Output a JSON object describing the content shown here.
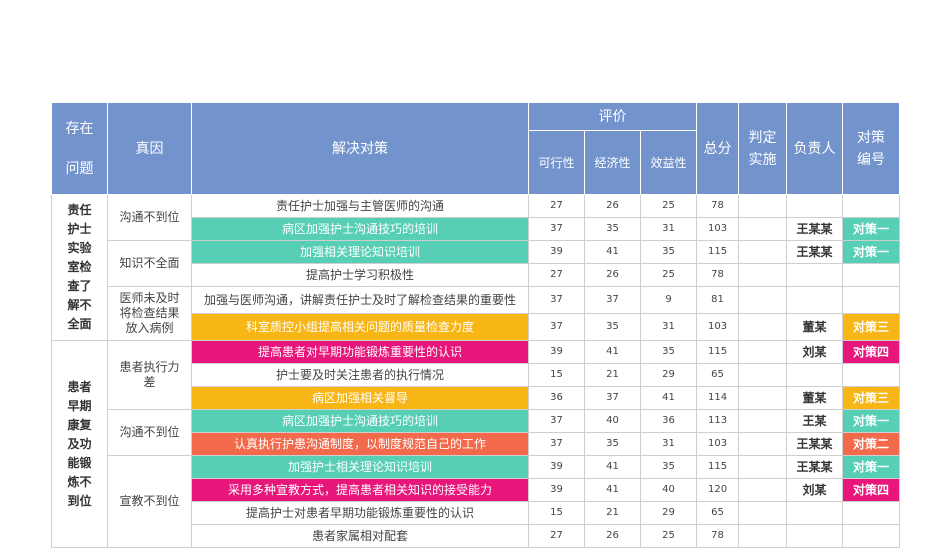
{
  "headers": {
    "problem_line1": "存在",
    "problem_line2": "问题",
    "cause": "真因",
    "measure": "解决对策",
    "evaluation": "评价",
    "feasibility": "可行性",
    "economy": "经济性",
    "benefit": "效益性",
    "total": "总分",
    "decision_line1": "判定",
    "decision_line2": "实施",
    "owner": "负责人",
    "code_line1": "对策",
    "code_line2": "编号"
  },
  "colors": {
    "header": "#7393cc",
    "green": "#56cfb5",
    "orange": "#f8b616",
    "pink": "#e8157b",
    "red": "#f26a4b"
  },
  "groups": [
    {
      "problem": "责任护士实验室检查了解不全面",
      "problem_lines": [
        "责任",
        "护士",
        "实验",
        "室检",
        "查了",
        "解不",
        "全面"
      ],
      "causes": [
        {
          "cause": "沟通不到位",
          "rows": [
            {
              "measure": "责任护士加强与主管医师的沟通",
              "feasibility": "27",
              "economy": "26",
              "benefit": "25",
              "total": "78",
              "owner": "",
              "code": "",
              "color": ""
            },
            {
              "measure": "病区加强护士沟通技巧的培训",
              "feasibility": "37",
              "economy": "35",
              "benefit": "31",
              "total": "103",
              "owner": "王某某",
              "code": "对策一",
              "color": "green"
            }
          ]
        },
        {
          "cause": "知识不全面",
          "rows": [
            {
              "measure": "加强相关理论知识培训",
              "feasibility": "39",
              "economy": "41",
              "benefit": "35",
              "total": "115",
              "owner": "王某某",
              "code": "对策一",
              "color": "green"
            },
            {
              "measure": "提高护士学习积极性",
              "feasibility": "27",
              "economy": "26",
              "benefit": "25",
              "total": "78",
              "owner": "",
              "code": "",
              "color": ""
            }
          ]
        },
        {
          "cause": "医师未及时将检查结果放入病例",
          "cause_lines": [
            "医师未及时",
            "将检查结果",
            "放入病例"
          ],
          "rows": [
            {
              "measure": "加强与医师沟通，讲解责任护士及时了解检查结果的重要性",
              "feasibility": "37",
              "economy": "37",
              "benefit": "9",
              "total": "81",
              "owner": "",
              "code": "",
              "color": ""
            },
            {
              "measure": "科室质控小组提高相关问题的质量检查力度",
              "feasibility": "37",
              "economy": "35",
              "benefit": "31",
              "total": "103",
              "owner": "董某",
              "code": "对策三",
              "color": "orange"
            }
          ]
        }
      ]
    },
    {
      "problem": "患者早期康复及功能锻炼不到位",
      "problem_lines": [
        "患者",
        "早期",
        "康复",
        "及功",
        "能锻",
        "炼不",
        "到位"
      ],
      "causes": [
        {
          "cause": "患者执行力差",
          "cause_lines": [
            "患者执行力",
            "差"
          ],
          "rows": [
            {
              "measure": "提高患者对早期功能锻炼重要性的认识",
              "feasibility": "39",
              "economy": "41",
              "benefit": "35",
              "total": "115",
              "owner": "刘某",
              "code": "对策四",
              "color": "pink"
            },
            {
              "measure": "护士要及时关注患者的执行情况",
              "feasibility": "15",
              "economy": "21",
              "benefit": "29",
              "total": "65",
              "owner": "",
              "code": "",
              "color": ""
            },
            {
              "measure": "病区加强相关督导",
              "feasibility": "36",
              "economy": "37",
              "benefit": "41",
              "total": "114",
              "owner": "董某",
              "code": "对策三",
              "color": "orange"
            }
          ]
        },
        {
          "cause": "沟通不到位",
          "rows": [
            {
              "measure": "病区加强护士沟通技巧的培训",
              "feasibility": "37",
              "economy": "40",
              "benefit": "36",
              "total": "113",
              "owner": "王某",
              "code": "对策一",
              "color": "green"
            },
            {
              "measure": "认真执行护患沟通制度，以制度规范自己的工作",
              "feasibility": "37",
              "economy": "35",
              "benefit": "31",
              "total": "103",
              "owner": "王某某",
              "code": "对策二",
              "color": "red"
            }
          ]
        },
        {
          "cause": "宣教不到位",
          "rows": [
            {
              "measure": "加强护士相关理论知识培训",
              "feasibility": "39",
              "economy": "41",
              "benefit": "35",
              "total": "115",
              "owner": "王某某",
              "code": "对策一",
              "color": "green"
            },
            {
              "measure": "采用多种宣教方式，提高患者相关知识的接受能力",
              "feasibility": "39",
              "economy": "41",
              "benefit": "40",
              "total": "120",
              "owner": "刘某",
              "code": "对策四",
              "color": "pink"
            },
            {
              "measure": "提高护士对患者早期功能锻炼重要性的认识",
              "feasibility": "15",
              "economy": "21",
              "benefit": "29",
              "total": "65",
              "owner": "",
              "code": "",
              "color": ""
            },
            {
              "measure": "患者家属相对配套",
              "feasibility": "27",
              "economy": "26",
              "benefit": "25",
              "total": "78",
              "owner": "",
              "code": "",
              "color": ""
            }
          ]
        }
      ]
    }
  ]
}
